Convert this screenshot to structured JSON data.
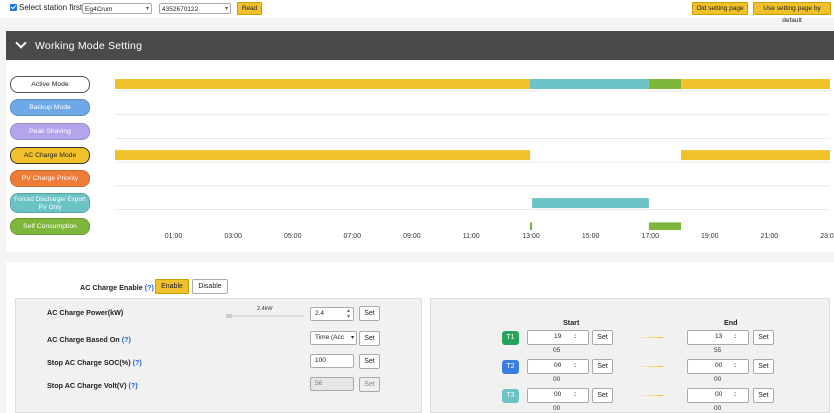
{
  "topbar": {
    "select_station_label": "Select station first",
    "station_value": "Eg4Crum",
    "serial_value": "4352670122",
    "read_label": "Read",
    "old_setting_label": "Old setting page",
    "default_setting_label": "Use setting page by default"
  },
  "section": {
    "title": "Working Mode Setting"
  },
  "modes": [
    {
      "label": "Active Mode",
      "color": "#ffffff"
    },
    {
      "label": "Backup Mode",
      "color": "#6fa8e6"
    },
    {
      "label": "Peak Shaving",
      "color": "#b3a4ec"
    },
    {
      "label": "AC Charge Mode",
      "color": "#f0c12a"
    },
    {
      "label": "PV Charge Priority",
      "color": "#ef7b38"
    },
    {
      "label": "Forced Discharge/ Export PV Only",
      "color": "#6cc3c6"
    },
    {
      "label": "Self Consumption",
      "color": "#7db63a"
    }
  ],
  "chart_data": {
    "type": "timeline",
    "x_ticks": [
      "01:00",
      "03:00",
      "05:00",
      "07:00",
      "09:00",
      "11:00",
      "13:00",
      "15:00",
      "17:00",
      "19:00",
      "21:00",
      "23:00"
    ],
    "rows": [
      {
        "mode": "Active Mode",
        "segments": [
          {
            "start": 0.0,
            "end": 13.93,
            "color": "#f0c12a"
          },
          {
            "start": 13.93,
            "end": 17.92,
            "color": "#6cc3c6"
          },
          {
            "start": 17.92,
            "end": 19.0,
            "color": "#7db63a"
          },
          {
            "start": 19.0,
            "end": 24.0,
            "color": "#f0c12a"
          }
        ]
      },
      {
        "mode": "Backup Mode",
        "segments": []
      },
      {
        "mode": "Peak Shaving",
        "segments": []
      },
      {
        "mode": "AC Charge Mode",
        "segments": [
          {
            "start": 0.0,
            "end": 13.93,
            "color": "#f0c12a"
          },
          {
            "start": 19.0,
            "end": 24.0,
            "color": "#f0c12a"
          }
        ]
      },
      {
        "mode": "PV Charge Priority",
        "segments": []
      },
      {
        "mode": "Forced Discharge/ Export PV Only",
        "segments": [
          {
            "start": 14.0,
            "end": 17.92,
            "color": "#6cc3c6"
          }
        ]
      },
      {
        "mode": "Self Consumption",
        "segments": [
          {
            "start": 13.93,
            "end": 14.0,
            "color": "#7db63a"
          },
          {
            "start": 17.92,
            "end": 19.0,
            "color": "#7db63a"
          }
        ]
      }
    ],
    "xlim": [
      0,
      24
    ]
  },
  "ac_charge": {
    "enable_label": "AC Charge Enable",
    "help": "(?)",
    "enable_btn": "Enable",
    "disable_btn": "Disable",
    "power_label": "AC Charge Power(kW)",
    "power_slider_text": "2.4kW",
    "power_value": "2.4",
    "based_on_label": "AC Charge Based On",
    "based_on_value": "Time (Acc",
    "stop_soc_label": "Stop AC Charge SOC(%)",
    "stop_soc_value": "100",
    "stop_volt_label": "Stop AC Charge Volt(V)",
    "stop_volt_value": "56",
    "set_label": "Set"
  },
  "time_table": {
    "start_label": "Start",
    "end_label": "End",
    "set_label": "Set",
    "periods": [
      {
        "label": "T1",
        "color": "#27a35a",
        "start_h": "19",
        "start_m": "05",
        "end_h": "13",
        "end_m": "55"
      },
      {
        "label": "T2",
        "color": "#3a7ee0",
        "start_h": "00",
        "start_m": "00",
        "end_h": "00",
        "end_m": "00"
      },
      {
        "label": "T3",
        "color": "#6cc3c6",
        "start_h": "00",
        "start_m": "00",
        "end_h": "00",
        "end_m": "00"
      }
    ],
    "separator": ":"
  }
}
